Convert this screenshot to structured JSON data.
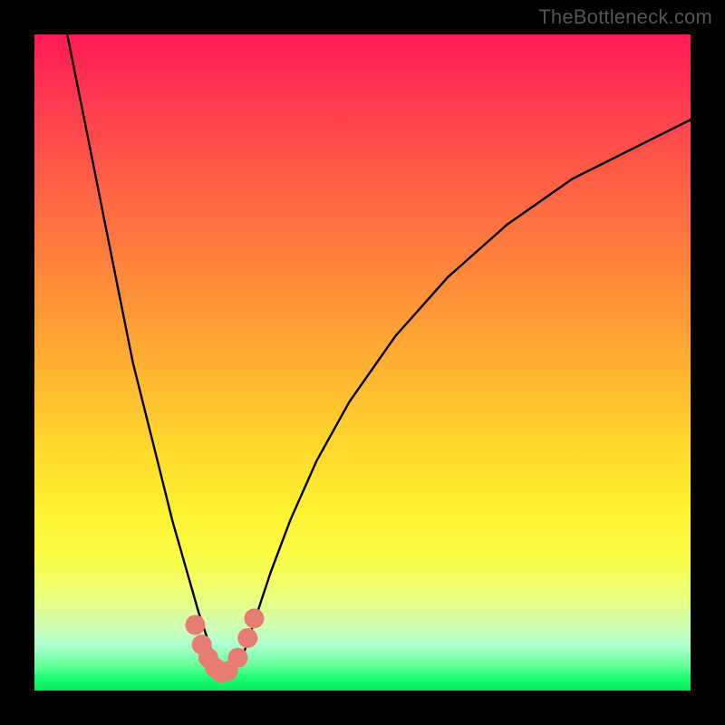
{
  "watermark": "TheBottleneck.com",
  "chart_data": {
    "type": "line",
    "title": "",
    "xlabel": "",
    "ylabel": "",
    "xlim": [
      0,
      100
    ],
    "ylim": [
      0,
      100
    ],
    "grid": false,
    "series": [
      {
        "name": "bottleneck-curve",
        "x": [
          5,
          7,
          9,
          11,
          13,
          15,
          17,
          19,
          21,
          23,
          25,
          26,
          27,
          27.5,
          28,
          28.5,
          29,
          30,
          31,
          32,
          33,
          34,
          36,
          39,
          43,
          48,
          55,
          63,
          72,
          82,
          92,
          100
        ],
        "y": [
          100,
          90,
          80,
          70,
          60,
          50,
          42,
          34,
          26,
          19,
          12,
          9,
          6,
          4,
          3,
          2.5,
          2.5,
          3,
          4,
          6,
          9,
          12,
          18,
          26,
          35,
          44,
          54,
          63,
          71,
          78,
          83,
          87
        ],
        "color": "#000000"
      }
    ],
    "markers": {
      "name": "highlight-cluster",
      "color": "#e77c73",
      "points": [
        {
          "x": 24.5,
          "y": 10
        },
        {
          "x": 25.5,
          "y": 7
        },
        {
          "x": 26.5,
          "y": 5
        },
        {
          "x": 27.5,
          "y": 3.5
        },
        {
          "x": 28.5,
          "y": 2.7
        },
        {
          "x": 29.5,
          "y": 3
        },
        {
          "x": 31.0,
          "y": 5
        },
        {
          "x": 32.5,
          "y": 8
        },
        {
          "x": 33.5,
          "y": 11
        }
      ],
      "size": 11
    },
    "background_gradient": {
      "top": "#ff1a55",
      "mid_upper": "#ff8c3a",
      "mid": "#ffd62e",
      "mid_lower": "#fbff4a",
      "bottom": "#03e85d"
    }
  }
}
